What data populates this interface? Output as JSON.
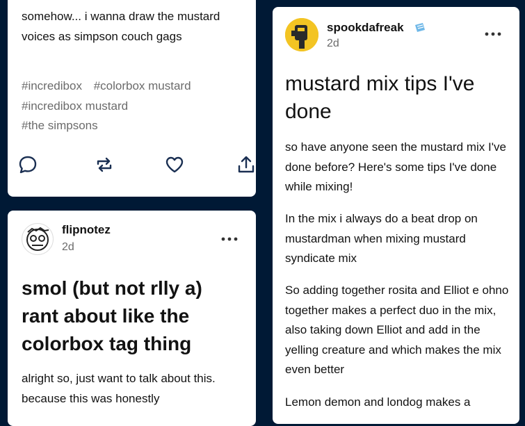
{
  "posts": [
    {
      "body": "somehow... i wanna draw the mustard voices as simpson couch gags",
      "tags": [
        "#incredibox",
        "#colorbox mustard",
        "#incredibox mustard",
        "#the simpsons"
      ]
    },
    {
      "username": "flipnotez",
      "time": "2d",
      "title": "smol (but not rlly a) rant about like the colorbox tag thing",
      "body": "alright so, just want to talk about this. because this was honestly"
    },
    {
      "username": "spookdafreak",
      "time": "2d",
      "title": "mustard mix tips I've done",
      "paragraphs": [
        "so have anyone seen the mustard mix I've done before? Here's some tips I've done while mixing!",
        "In the mix i always do a beat drop on mustardman when mixing mustard syndicate mix",
        "So adding together rosita and Elliot e ohno together makes a perfect duo in the mix, also taking down Elliot and add in the yelling creature and which makes the mix even better",
        "Lemon demon and londog makes a"
      ]
    }
  ],
  "icons": {
    "comment": "comment-icon",
    "reblog": "reblog-icon",
    "like": "heart-icon",
    "share": "share-icon",
    "more": "more-options-icon",
    "badge": "blue-badge-icon"
  },
  "colors": {
    "background": "#001935",
    "card": "#ffffff",
    "text": "#121212",
    "muted": "#6b6b6b",
    "icon": "#1a2f52",
    "badge": "#6fb8e8"
  }
}
